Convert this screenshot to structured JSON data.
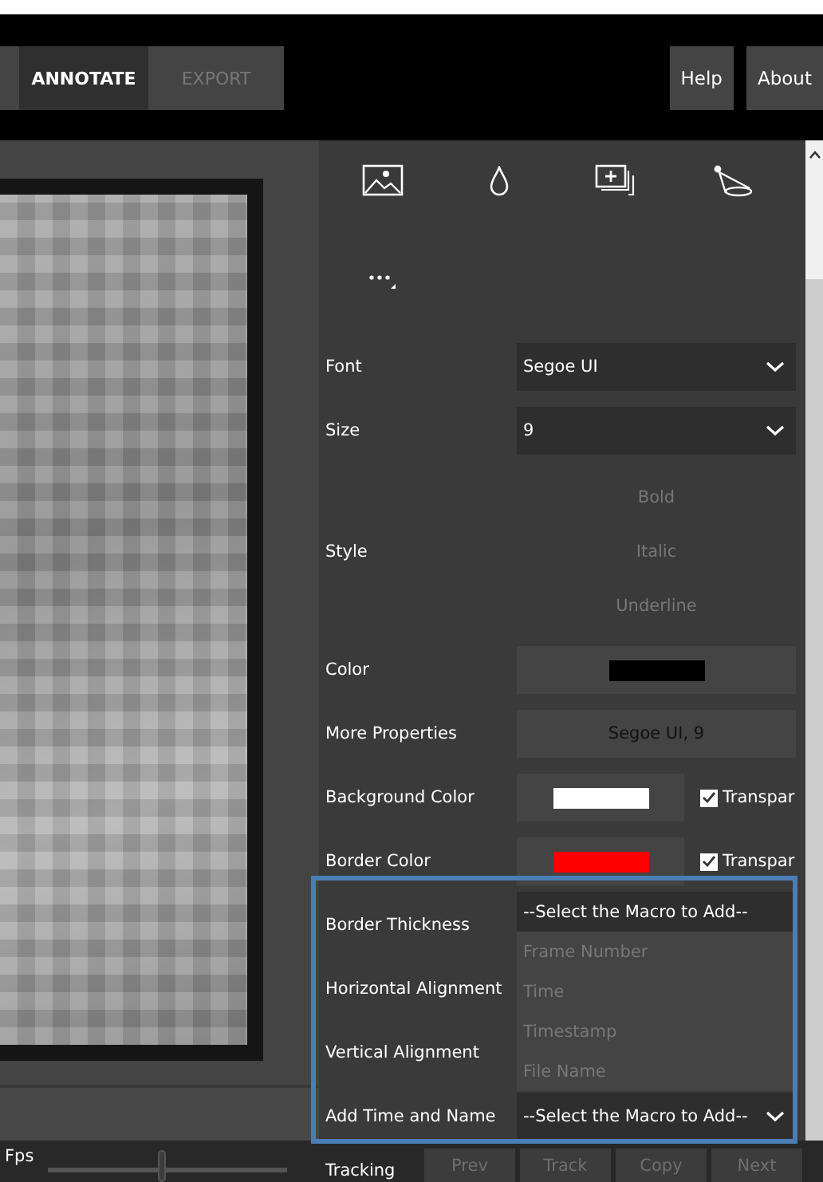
{
  "tabs": [
    {
      "label": "ANNOTATE",
      "selected": true
    },
    {
      "label": "EXPORT",
      "selected": false
    }
  ],
  "header_buttons": [
    "Help",
    "About"
  ],
  "properties": [
    {
      "kind": "dropdown",
      "label": "Font",
      "value": "Segoe UI"
    },
    {
      "kind": "dropdown",
      "label": "Size",
      "value": "9"
    },
    {
      "kind": "style",
      "label": "Style",
      "options": [
        {
          "label": "Bold",
          "selected": false
        },
        {
          "label": "Italic",
          "selected": false
        },
        {
          "label": "Underline",
          "selected": false
        }
      ]
    },
    {
      "kind": "color",
      "label": "Color",
      "color": "#000000"
    },
    {
      "kind": "button",
      "label": "More Properties",
      "value": "Segoe UI, 9"
    },
    {
      "kind": "color_check",
      "label": "Background Color",
      "color": "#ffffff",
      "check_label": "Transpar",
      "checked": true
    },
    {
      "kind": "color_check",
      "label": "Border Color",
      "color": "#ff0000",
      "check_label": "Transpar",
      "checked": true
    },
    {
      "kind": "blank",
      "label": "Border Thickness"
    },
    {
      "kind": "blank",
      "label": "Horizontal Alignment"
    },
    {
      "kind": "blank",
      "label": "Vertical Alignment"
    },
    {
      "kind": "dropdown",
      "label": "Add Time and Name",
      "value": "--Select the Macro to Add--"
    }
  ],
  "macro_list": [
    {
      "label": "--Select the Macro to Add--",
      "selected": true
    },
    {
      "label": "Frame Number",
      "selected": false
    },
    {
      "label": "Time",
      "selected": false
    },
    {
      "label": "Timestamp",
      "selected": false
    },
    {
      "label": "File Name",
      "selected": false
    }
  ],
  "bottom_bar": {
    "fps_label": "Fps",
    "fps_slider": {
      "level": 0.48
    },
    "tracking_label": "Tracking",
    "tracking_buttons": [
      {
        "label": "Prev",
        "disabled": true
      },
      {
        "label": "Track",
        "disabled": true
      },
      {
        "label": "Copy",
        "disabled": true
      },
      {
        "label": "Next",
        "disabled": true
      }
    ]
  }
}
